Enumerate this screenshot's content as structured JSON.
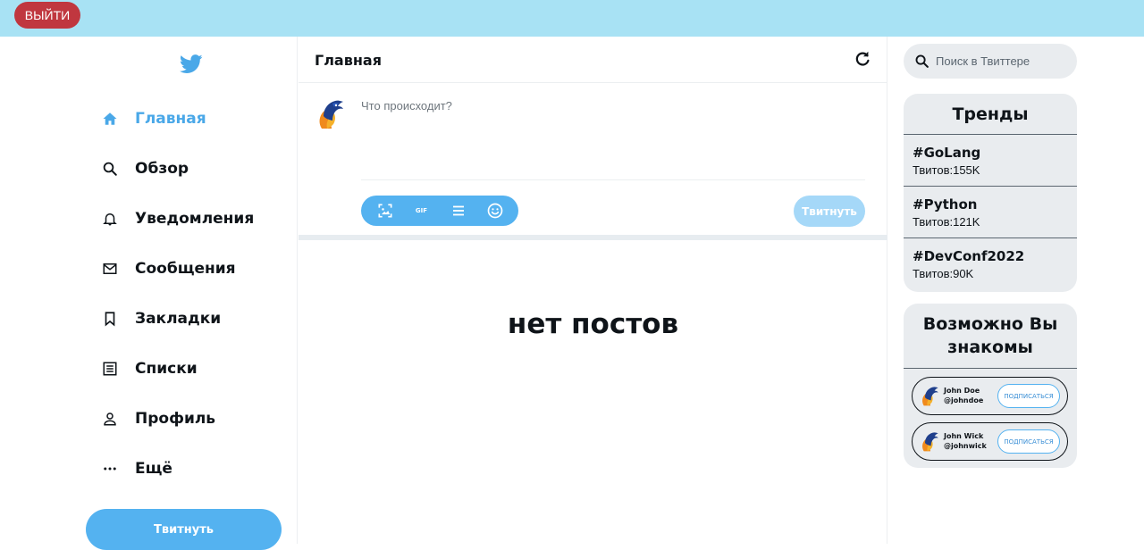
{
  "topbar": {
    "logout_label": "ВЫЙТИ"
  },
  "sidebar": {
    "items": [
      {
        "label": "Главная",
        "icon": "home-icon",
        "active": true
      },
      {
        "label": "Обзор",
        "icon": "search-icon"
      },
      {
        "label": "Уведомления",
        "icon": "bell-icon"
      },
      {
        "label": "Сообщения",
        "icon": "mail-icon"
      },
      {
        "label": "Закладки",
        "icon": "bookmark-icon"
      },
      {
        "label": "Списки",
        "icon": "list-icon"
      },
      {
        "label": "Профиль",
        "icon": "profile-icon"
      },
      {
        "label": "Ещё",
        "icon": "more-icon"
      }
    ],
    "tweet_button": "Твитнуть"
  },
  "main": {
    "title": "Главная",
    "compose_placeholder": "Что происходит?",
    "gif_label": "GIF",
    "tweet_button": "Твитнуть",
    "empty_text": "нет постов"
  },
  "search": {
    "placeholder": "Поиск в Твиттере"
  },
  "trends": {
    "title": "Тренды",
    "items": [
      {
        "tag": "#GoLang",
        "count": "Твитов:155K"
      },
      {
        "tag": "#Python",
        "count": "Твитов:121K"
      },
      {
        "tag": "#DevConf2022",
        "count": "Твитов:90K"
      }
    ]
  },
  "who_to_follow": {
    "title": "Возможно Вы знакомы",
    "people": [
      {
        "name": "John Doe",
        "handle": "@johndoe",
        "button": "ПОДПИСАТЬСЯ"
      },
      {
        "name": "John Wick",
        "handle": "@johnwick",
        "button": "ПОДПИСАТЬСЯ"
      }
    ]
  },
  "colors": {
    "topbar": "#a8e2f4",
    "accent": "#54b2f0",
    "logout": "#c0373f",
    "panel": "#e9ecef"
  }
}
